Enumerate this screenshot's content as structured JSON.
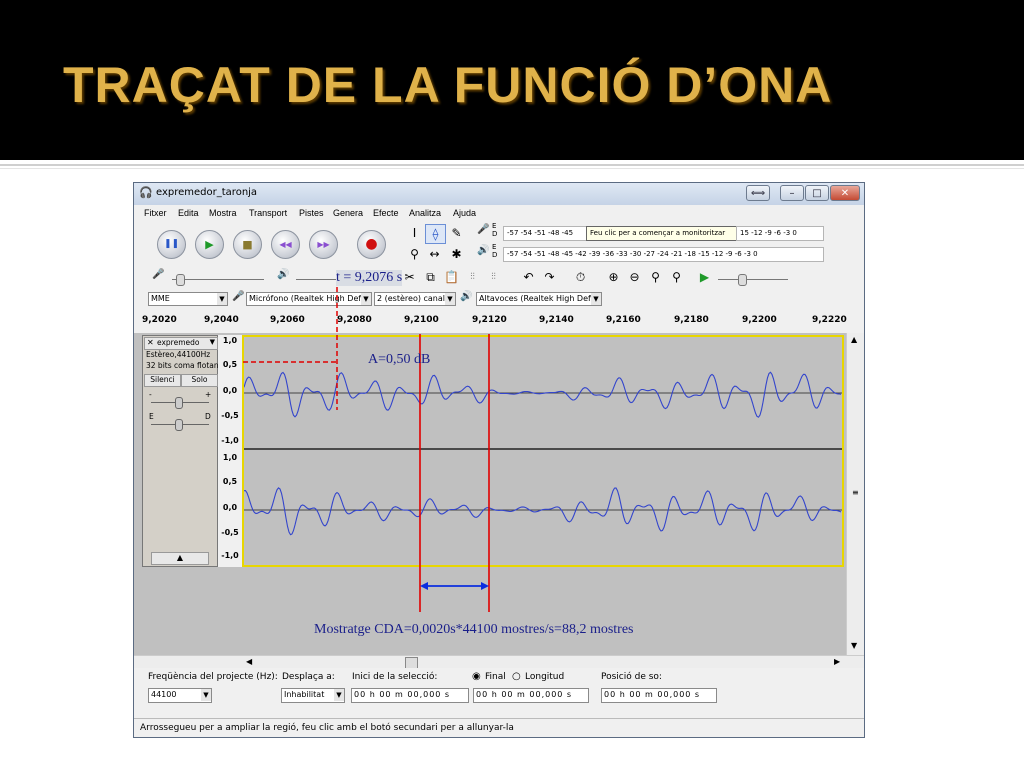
{
  "slide": {
    "title": "TRAÇAT DE LA FUNCIÓ D’ONA"
  },
  "window": {
    "title": "expremedor_taronja",
    "controls": {
      "restore": "⟺",
      "minimize": "–",
      "maximize": "□",
      "close": "✕"
    }
  },
  "menu": [
    "Fitxer",
    "Edita",
    "Mostra",
    "Transport",
    "Pistes",
    "Genera",
    "Efecte",
    "Analitza",
    "Ajuda"
  ],
  "transport": {
    "pause": "❚❚",
    "play": "▶",
    "stop": "■",
    "skip_start": "◀◀",
    "skip_end": "▶▶",
    "record": "●"
  },
  "meters": {
    "record_scale": "-57 -54 -51 -48 -45",
    "record_tooltip": "Feu clic per a començar a monitoritzar",
    "record_scale_end": "15 -12 -9 -6 -3 0",
    "record_channels": "E D",
    "play_scale": "-57 -54 -51 -48 -45 -42 -39 -36 -33 -30 -27 -24 -21 -18 -15 -12 -9 -6 -3 0",
    "play_channels": "E D"
  },
  "devices": {
    "host": "MME",
    "mic": "Micrófono (Realtek High Defi",
    "channels": "2 (estèreo) canal",
    "speakers": "Altavoces (Realtek High Defin"
  },
  "ruler": {
    "ticks": [
      "9,2020",
      "9,2040",
      "9,2060",
      "9,2080",
      "9,2100",
      "9,2120",
      "9,2140",
      "9,2160",
      "9,2180",
      "9,2200",
      "9,2220"
    ]
  },
  "track": {
    "name": "expremedo",
    "info1": "Estèreo,44100Hz",
    "info2": "32 bits coma flotan",
    "silence": "Silenci",
    "solo": "Solo",
    "minus": "-",
    "plus": "+",
    "left": "E",
    "right": "D",
    "collapse": "▲"
  },
  "amplitude_labels": [
    "1,0",
    "0,5",
    "0,0",
    "-0,5",
    "-1,0"
  ],
  "annotations": {
    "time": "t = 9,2076 s",
    "amplitude": "A=0,50 dB",
    "sampling": "Mostratge CDA=0,0020s*44100 mostres/s=88,2 mostres"
  },
  "bottom": {
    "rate_label": "Freqüència del projecte (Hz):",
    "rate_value": "44100",
    "snap_label": "Desplaça a:",
    "snap_value": "Inhabilitat",
    "sel_start_label": "Inici de la selecció:",
    "sel_start_value": "00 h 00 m 00,000 s",
    "final_label": "Final",
    "length_label": "Longitud",
    "sel_end_value": "00 h 00 m 00,000 s",
    "pos_label": "Posició de so:",
    "pos_value": "00 h 00 m 00,000 s"
  },
  "status": "Arrossegueu per a ampliar la regió, feu clic amb el botó secundari per a allunyar-la",
  "colors": {
    "title_gold": "#e0b24a",
    "wave_blue": "#3345cc",
    "marker_red": "#e00000",
    "annotation_blue": "#1a1f8a",
    "arrow_blue": "#0b2ee0"
  }
}
